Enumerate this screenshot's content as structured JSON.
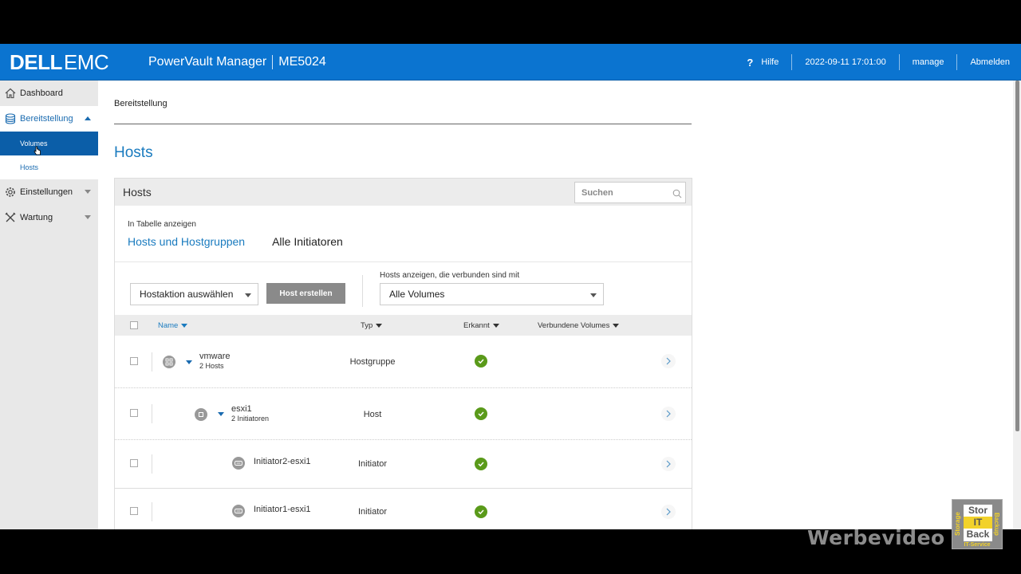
{
  "topbar": {
    "logo_dell": "DELL",
    "logo_emc": "EMC",
    "app_title": "PowerVault Manager",
    "model": "ME5024",
    "help_label": "Hilfe",
    "help_icon": "question-icon",
    "datetime": "2022-09-11 17:01:00",
    "user": "manage",
    "logout_label": "Abmelden"
  },
  "sidebar": {
    "items": [
      {
        "label": "Dashboard",
        "icon": "home-icon"
      },
      {
        "label": "Bereitstellung",
        "icon": "database-icon",
        "expanded": true,
        "children": [
          {
            "label": "Volumes",
            "active": true
          },
          {
            "label": "Hosts",
            "active": false
          }
        ]
      },
      {
        "label": "Einstellungen",
        "icon": "gear-icon"
      },
      {
        "label": "Wartung",
        "icon": "tools-icon"
      }
    ]
  },
  "main": {
    "breadcrumb": "Bereitstellung",
    "page_title": "Hosts",
    "panel": {
      "title": "Hosts",
      "search_placeholder": "Suchen",
      "show_in_table_label": "In Tabelle anzeigen",
      "tabs": [
        {
          "label": "Hosts und Hostgruppen",
          "active": true
        },
        {
          "label": "Alle Initiatoren",
          "active": false
        }
      ],
      "host_action_select": "Hostaktion auswählen",
      "create_host_button": "Host erstellen",
      "filter_label": "Hosts anzeigen, die verbunden sind mit",
      "filter_select": "Alle Volumes",
      "columns": [
        {
          "label": "Name",
          "sorted": true
        },
        {
          "label": "Typ",
          "sorted": false
        },
        {
          "label": "Erkannt",
          "sorted": false
        },
        {
          "label": "Verbundene Volumes",
          "sorted": false
        }
      ],
      "rows": [
        {
          "name": "vmware",
          "sub": "2 Hosts",
          "type": "Hostgruppe",
          "discovered": true,
          "level": 0,
          "icon": "host-group-icon",
          "expandable": true
        },
        {
          "name": "esxi1",
          "sub": "2 Initiatoren",
          "type": "Host",
          "discovered": true,
          "level": 1,
          "icon": "host-icon",
          "expandable": true
        },
        {
          "name": "Initiator2-esxi1",
          "sub": "",
          "type": "Initiator",
          "discovered": true,
          "level": 2,
          "icon": "initiator-icon",
          "expandable": false
        },
        {
          "name": "Initiator1-esxi1",
          "sub": "",
          "type": "Initiator",
          "discovered": true,
          "level": 2,
          "icon": "initiator-icon",
          "expandable": false
        }
      ]
    }
  },
  "overlay": {
    "watermark": "Werbevideo",
    "badge": {
      "line1": "Stor",
      "line2": "IT",
      "line3": "Back",
      "left": "Storage",
      "right": "Backup",
      "bottom": "IT-Service"
    }
  },
  "colors": {
    "brand_blue": "#0b74d0",
    "active_nav": "#0b5ea8",
    "link_blue": "#1a7bbf",
    "ok_green": "#5a9a1a"
  }
}
